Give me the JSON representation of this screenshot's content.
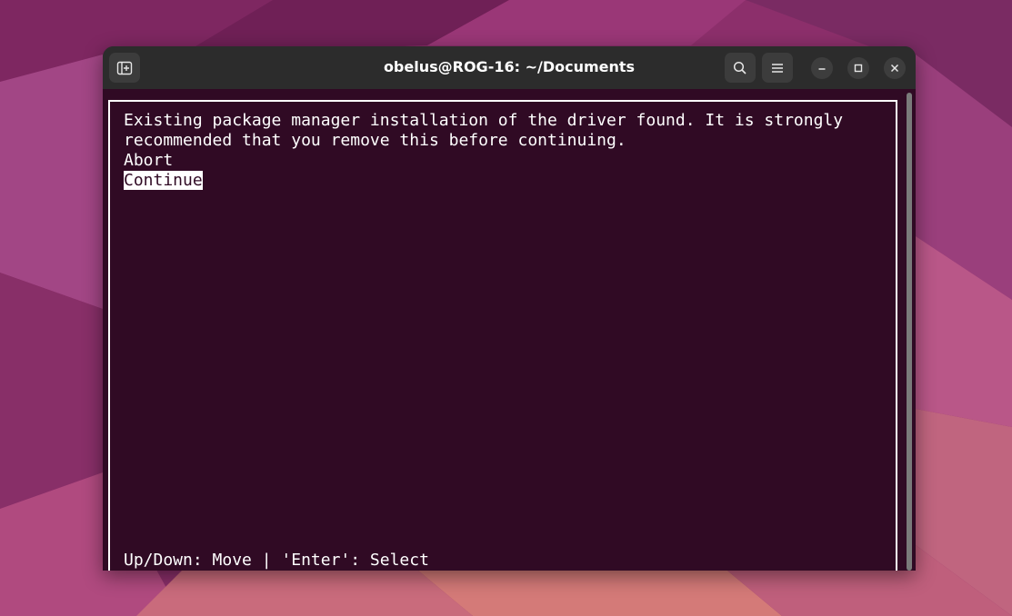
{
  "window": {
    "title": "obelus@ROG-16: ~/Documents"
  },
  "titlebar": {
    "new_tab_icon": "new-tab-icon",
    "search_icon": "search-icon",
    "menu_icon": "hamburger-menu-icon",
    "minimize_icon": "minimize-icon",
    "maximize_icon": "maximize-icon",
    "close_icon": "close-icon"
  },
  "terminal": {
    "message_line1": "Existing package manager installation of the driver found. It is strongly",
    "message_line2": "recommended that you remove this before continuing.",
    "options": [
      "Abort",
      "Continue"
    ],
    "selected_option": "Continue",
    "footer": "Up/Down: Move | 'Enter': Select"
  },
  "colors": {
    "terminal_bg": "#300a24",
    "titlebar_bg": "#2c2c2c",
    "text": "#ffffff"
  }
}
